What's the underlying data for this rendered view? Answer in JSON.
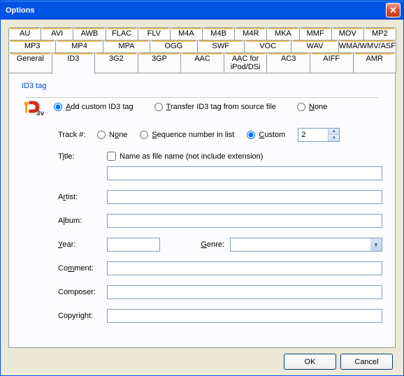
{
  "window": {
    "title": "Options"
  },
  "tabs": {
    "row1": [
      "AU",
      "AVI",
      "AWB",
      "FLAC",
      "FLV",
      "M4A",
      "M4B",
      "M4R",
      "MKA",
      "MMF",
      "MOV",
      "MP2"
    ],
    "row2": [
      "MP3",
      "MP4",
      "MPA",
      "OGG",
      "SWF",
      "VOC",
      "WAV",
      "WMA/WMV/ASF"
    ],
    "row3": [
      "General",
      "ID3",
      "3G2",
      "3GP",
      "AAC",
      "AAC for iPod/DSi",
      "AC3",
      "AIFF",
      "AMR"
    ]
  },
  "fieldset": "ID3 tag",
  "tag_mode": {
    "add": "Add custom ID3 tag",
    "add_u": "A",
    "transfer": "Transfer ID3 tag from source file",
    "transfer_u": "T",
    "none": "None",
    "none_u": "N"
  },
  "track": {
    "label": "Track #:",
    "none": "None",
    "none_u": "o",
    "seq": "Sequence number in list",
    "seq_u": "S",
    "custom": "Custom",
    "custom_u": "C",
    "value": "2"
  },
  "title": {
    "label": "Title:",
    "label_u": "i",
    "name_as_file": "Name as file name (not include extension)"
  },
  "fields": {
    "artist": "Artist:",
    "artist_u": "r",
    "album": "Album:",
    "album_u": "l",
    "year": "Year:",
    "year_u": "Y",
    "genre": "Genre:",
    "genre_u": "G",
    "comment": "Comment:",
    "comment_u": "m",
    "composer": "Composer:",
    "copyright": "Copyright:"
  },
  "buttons": {
    "ok": "OK",
    "cancel": "Cancel"
  }
}
